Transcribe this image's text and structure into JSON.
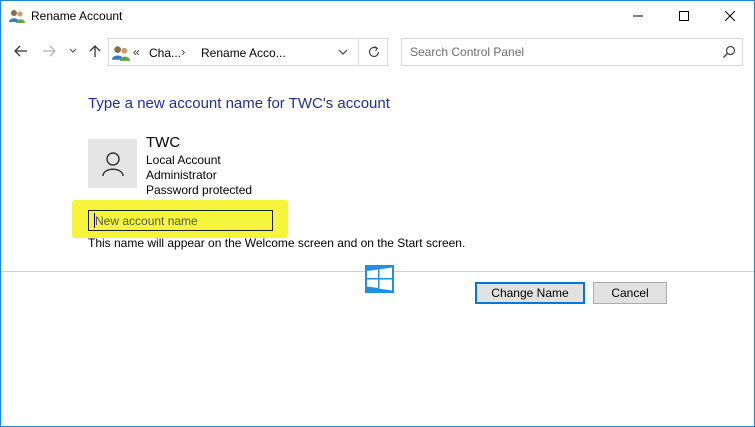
{
  "window": {
    "title": "Rename Account",
    "minimize_glyph": "—",
    "maximize_glyph": "☐",
    "close_glyph": "✕"
  },
  "nav": {
    "back_icon": "arrow-left-icon",
    "forward_icon": "arrow-right-icon",
    "recent_icon": "chevron-down-icon",
    "up_icon": "arrow-up-icon"
  },
  "address": {
    "overflow": "«",
    "crumbs": [
      "Cha...",
      "Rename Acco..."
    ],
    "separator": "›"
  },
  "search": {
    "placeholder": "Search Control Panel"
  },
  "content": {
    "heading": "Type a new account name for TWC's account",
    "account": {
      "name": "TWC",
      "type": "Local Account",
      "role": "Administrator",
      "password": "Password protected"
    },
    "new_name_input": {
      "value": "",
      "placeholder": "New account name"
    },
    "hint": "This name will appear on the Welcome screen and on the Start screen."
  },
  "buttons": {
    "change_name": "Change Name",
    "cancel": "Cancel"
  },
  "colors": {
    "heading": "#1e3287",
    "highlight": "#f5f53c",
    "accent": "#0078d7",
    "logo_blue": "#1e90e0"
  }
}
